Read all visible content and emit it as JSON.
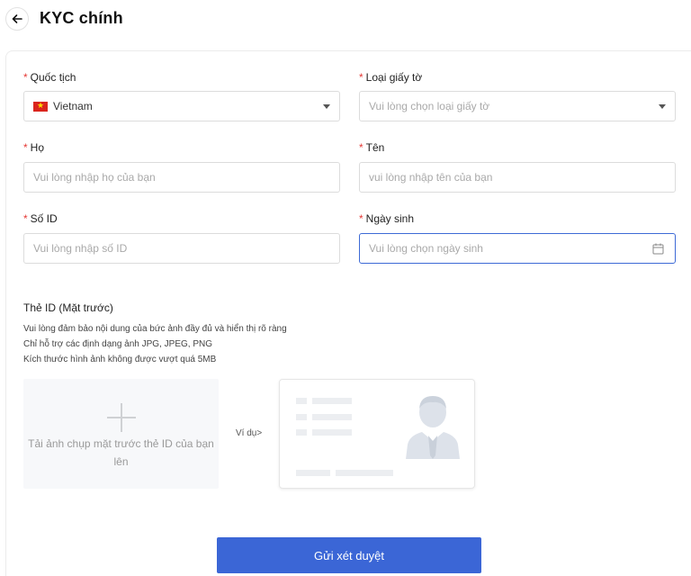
{
  "header": {
    "title": "KYC chính"
  },
  "form": {
    "nationality": {
      "label": "Quốc tịch",
      "value": "Vietnam"
    },
    "doc_type": {
      "label": "Loại giấy tờ",
      "placeholder": "Vui lòng chọn loại giấy tờ"
    },
    "last_name": {
      "label": "Họ",
      "placeholder": "Vui lòng nhập họ của bạn"
    },
    "first_name": {
      "label": "Tên",
      "placeholder": "vui lòng nhập tên của bạn"
    },
    "id_number": {
      "label": "Số ID",
      "placeholder": "Vui lòng nhập số ID"
    },
    "birth_date": {
      "label": "Ngày sinh",
      "placeholder": "Vui lòng chọn ngày sinh"
    },
    "required_mark": "*"
  },
  "upload": {
    "title": "Thẻ ID (Mặt trước)",
    "hints": [
      "Vui lòng đảm bảo nội dung của bức ảnh đầy đủ và hiển thị rõ ràng",
      "Chỉ hỗ trợ các định dạng ảnh JPG, JPEG, PNG",
      "Kích thước hình ảnh không được vượt quá 5MB"
    ],
    "box_text": "Tải ảnh chụp mặt trước thẻ ID của bạn lên",
    "example_label": "Ví dụ>"
  },
  "submit_label": "Gửi xét duyệt",
  "colors": {
    "accent": "#3b66d6",
    "required": "#e53935",
    "flag_red": "#da251d",
    "flag_star": "#ffde00"
  },
  "icons": {
    "back": "arrow-left-icon",
    "dropdown": "caret-down-icon",
    "calendar": "calendar-icon",
    "upload": "plus-icon",
    "example": "id-card-avatar-icon"
  }
}
